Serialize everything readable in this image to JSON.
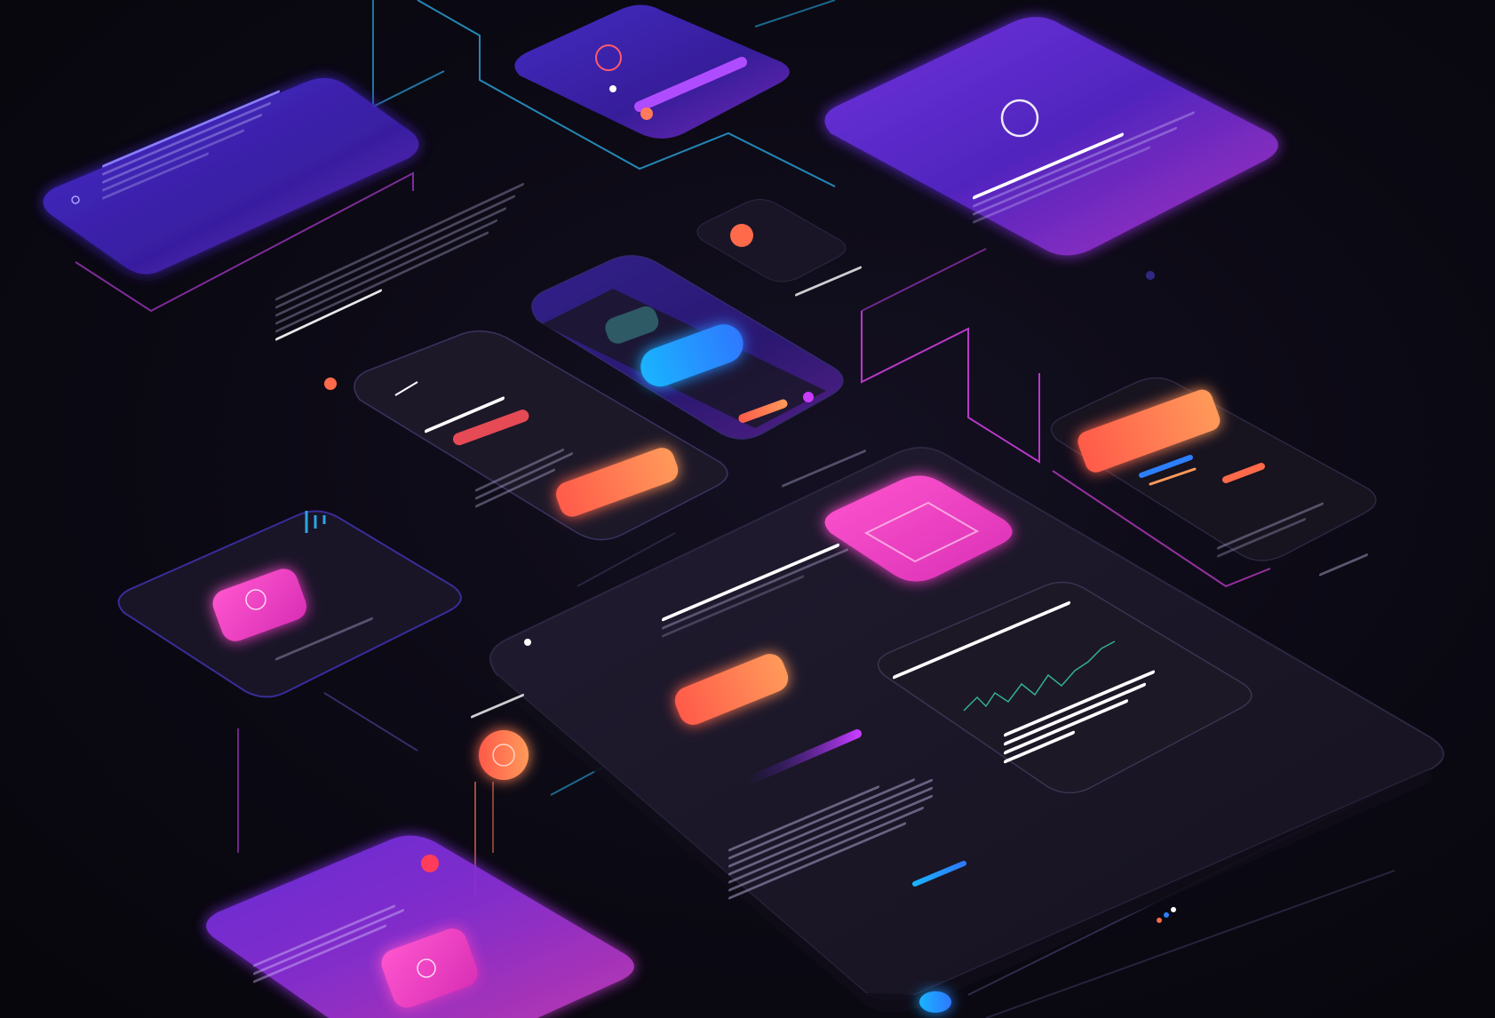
{
  "scene": {
    "accent_violet": "#5b2ee6",
    "accent_pink": "#ff4fc8",
    "accent_orange": "#ff6a4a",
    "accent_blue": "#1aa8ff",
    "background": "#0b0913"
  },
  "icons": {
    "circle": "circle-icon",
    "chat": "chat-bubble-icon",
    "alert": "alert-icon",
    "wave": "waveform-icon",
    "image": "image-icon",
    "fingerprint": "fingerprint-icon"
  }
}
